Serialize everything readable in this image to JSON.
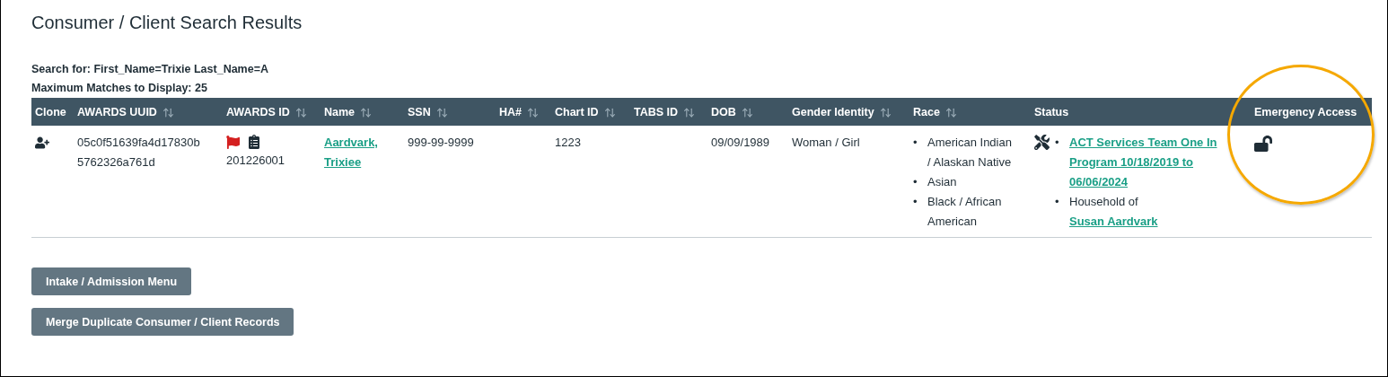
{
  "title": "Consumer / Client Search Results",
  "search_info": [
    "Search for: First_Name=Trixie Last_Name=A",
    "Maximum Matches to Display: 25"
  ],
  "table": {
    "columns": [
      {
        "label": "Clone",
        "sortable": false
      },
      {
        "label": "AWARDS UUID",
        "sortable": true
      },
      {
        "label": "AWARDS ID",
        "sortable": true
      },
      {
        "label": "Name",
        "sortable": true
      },
      {
        "label": "SSN",
        "sortable": true
      },
      {
        "label": "HA#",
        "sortable": true
      },
      {
        "label": "Chart ID",
        "sortable": true
      },
      {
        "label": "TABS ID",
        "sortable": true
      },
      {
        "label": "DOB",
        "sortable": true
      },
      {
        "label": "Gender Identity",
        "sortable": true
      },
      {
        "label": "Race",
        "sortable": true
      },
      {
        "label": "Status",
        "sortable": false
      },
      {
        "label": "Emergency Access",
        "sortable": false
      }
    ],
    "rows": [
      {
        "awards_uuid": "05c0f51639fa4d17830b5762326a761d",
        "flagged": true,
        "awards_id": "201226001",
        "name": "Aardvark, Trixiee",
        "ssn": "999-99-9999",
        "chart_id": "1223",
        "dob": "09/09/1989",
        "gender_identity": "Woman / Girl",
        "race": [
          {
            "marker": "•",
            "text": "American Indian / Alaskan Native"
          },
          {
            "marker": "•",
            "text": "Asian"
          },
          {
            "marker": "•",
            "text": "Black / African American"
          }
        ],
        "status": [
          {
            "kind": "program",
            "marker": "•",
            "link": "ACT Services Team One In Program 10/18/2019 to 06/06/2024"
          },
          {
            "kind": "household",
            "marker": "•",
            "prefix": "Household of",
            "link": "Susan Aardvark"
          }
        ],
        "emergency_locked": false
      }
    ]
  },
  "annotation": {
    "kind": "circle"
  },
  "buttons": [
    "Intake / Admission Menu",
    "Merge Duplicate Consumer / Client Records"
  ]
}
